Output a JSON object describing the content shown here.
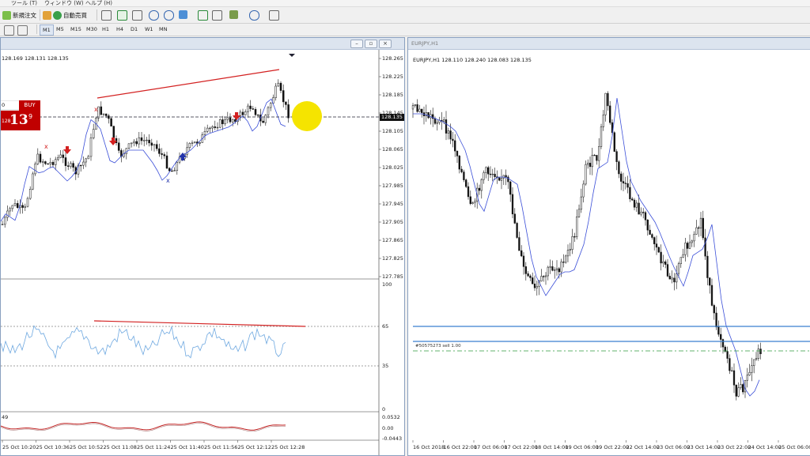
{
  "menu": {
    "tools": "ツール (T)",
    "window": "ウィンドウ (W)",
    "help": "ヘルプ (H)"
  },
  "toolbar": {
    "new_order": "新規注文",
    "auto_trading": "自動売買"
  },
  "timeframes": [
    "M1",
    "M5",
    "M15",
    "M30",
    "H1",
    "H4",
    "D1",
    "W1",
    "MN"
  ],
  "active_timeframe": "M1",
  "left_chart": {
    "ohlc_text": "128.169 128.131 128.135",
    "current_price": "128.135",
    "trade_panel": {
      "lot": "0",
      "buy_label": "BUY",
      "price_small": "128",
      "price_big": "13",
      "price_sup": "9"
    },
    "price_axis": [
      "128.265",
      "128.225",
      "128.185",
      "128.145",
      "128.105",
      "128.065",
      "128.025",
      "127.985",
      "127.945",
      "127.905",
      "127.865",
      "127.825",
      "127.785"
    ],
    "rsi_axis": [
      "100",
      "65",
      "35",
      "0"
    ],
    "osc_label": "49",
    "osc_axis": [
      "0.0532",
      "0.00",
      "-0.0443"
    ],
    "time_axis": [
      "25 Oct 10:20",
      "25 Oct 10:36",
      "25 Oct 10:52",
      "25 Oct 11:08",
      "25 Oct 11:24",
      "25 Oct 11:40",
      "25 Oct 11:56",
      "25 Oct 12:12",
      "25 Oct 12:28"
    ]
  },
  "right_chart": {
    "window_title": "EURJPY,H1",
    "ohlc_text": "EURJPY,H1  128.110 128.240 128.083 128.135",
    "order_label": "#50575273 sell 1.00",
    "time_axis": [
      "16 Oct 2018",
      "16 Oct 22:00",
      "17 Oct 06:00",
      "17 Oct 22:00",
      "18 Oct 14:00",
      "19 Oct 06:00",
      "19 Oct 22:00",
      "22 Oct 14:00",
      "23 Oct 06:00",
      "23 Oct 14:00",
      "23 Oct 22:00",
      "24 Oct 14:00",
      "25 Oct 06:00"
    ]
  },
  "colors": {
    "trendline": "#d32020",
    "ma": "#3b4fd8",
    "rsi": "#6ea8e0",
    "hline": "#3a7fd0",
    "highlight": "#f5e400",
    "buy_panel": "#c00000"
  }
}
